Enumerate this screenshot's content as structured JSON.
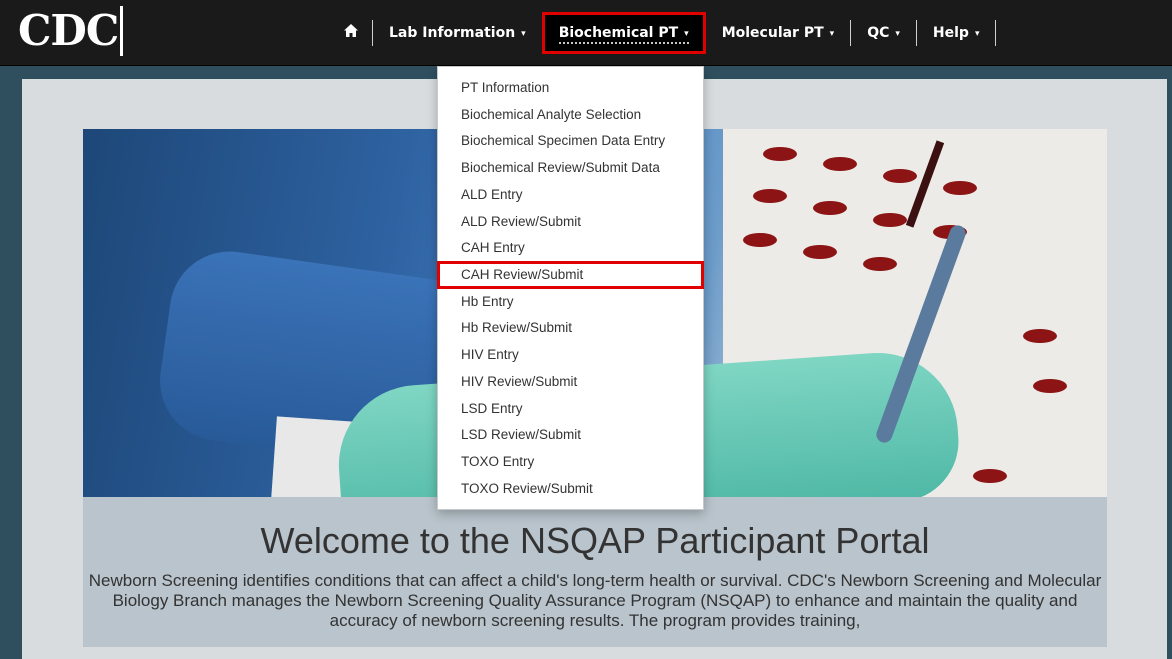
{
  "logo": "CDC",
  "nav": {
    "home_icon": "home-icon",
    "items": [
      {
        "label": "Lab Information",
        "caret": "▾"
      },
      {
        "label": "Biochemical PT",
        "caret": "▾"
      },
      {
        "label": "Molecular PT",
        "caret": "▾"
      },
      {
        "label": "QC",
        "caret": "▾"
      },
      {
        "label": "Help",
        "caret": "▾"
      }
    ]
  },
  "dropdown": {
    "items": [
      "PT Information",
      "Biochemical Analyte Selection",
      "Biochemical Specimen Data Entry",
      "Biochemical Review/Submit Data",
      "ALD Entry",
      "ALD Review/Submit",
      "CAH Entry",
      "CAH Review/Submit",
      "Hb Entry",
      "Hb Review/Submit",
      "HIV Entry",
      "HIV Review/Submit",
      "LSD Entry",
      "LSD Review/Submit",
      "TOXO Entry",
      "TOXO Review/Submit"
    ]
  },
  "main": {
    "welcome": "Welcome to the NSQAP Participant Portal",
    "intro": "Newborn Screening identifies conditions that can affect a child's long-term health or survival. CDC's Newborn Screening and Molecular Biology Branch manages the Newborn Screening Quality Assurance Program (NSQAP) to enhance and maintain the quality and accuracy of newborn screening results. The program provides training,"
  },
  "colors": {
    "navbar": "#1a1a1a",
    "highlight": "#e00000",
    "page_bg": "#2f4f5f",
    "panel_bg": "#d9dcdf"
  }
}
